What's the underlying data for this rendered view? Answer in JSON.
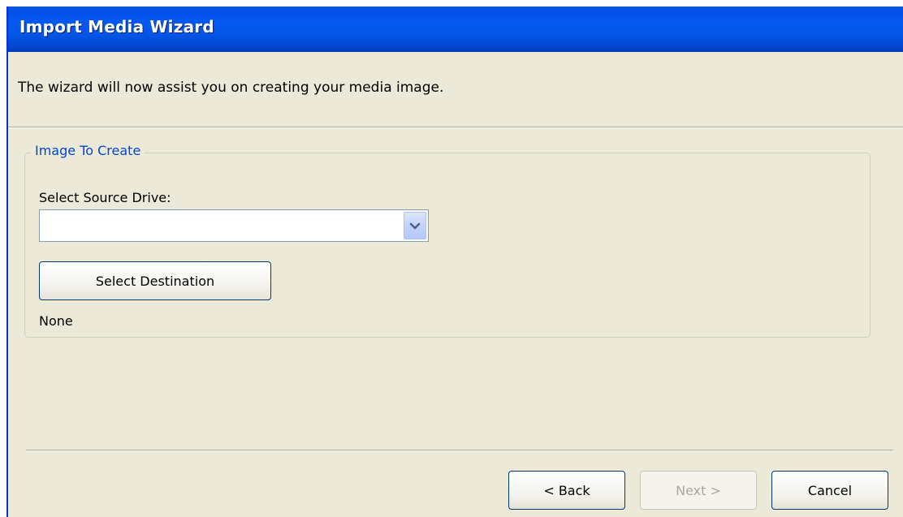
{
  "window": {
    "title": "Import Media Wizard"
  },
  "intro": {
    "text": "The wizard will now assist you on creating your media image."
  },
  "group": {
    "legend": "Image To Create",
    "source_label": "Select Source Drive:",
    "source_value": "",
    "dropdown_icon": "chevron-down-icon",
    "select_destination_label": "Select Destination",
    "destination_value": "None"
  },
  "footer": {
    "back_label": "< Back",
    "next_label": "Next >",
    "cancel_label": "Cancel"
  },
  "colors": {
    "titlebar": "#0558f0",
    "window_bg": "#ece9d8",
    "group_legend": "#0046d5",
    "disabled_text": "#aca899"
  }
}
